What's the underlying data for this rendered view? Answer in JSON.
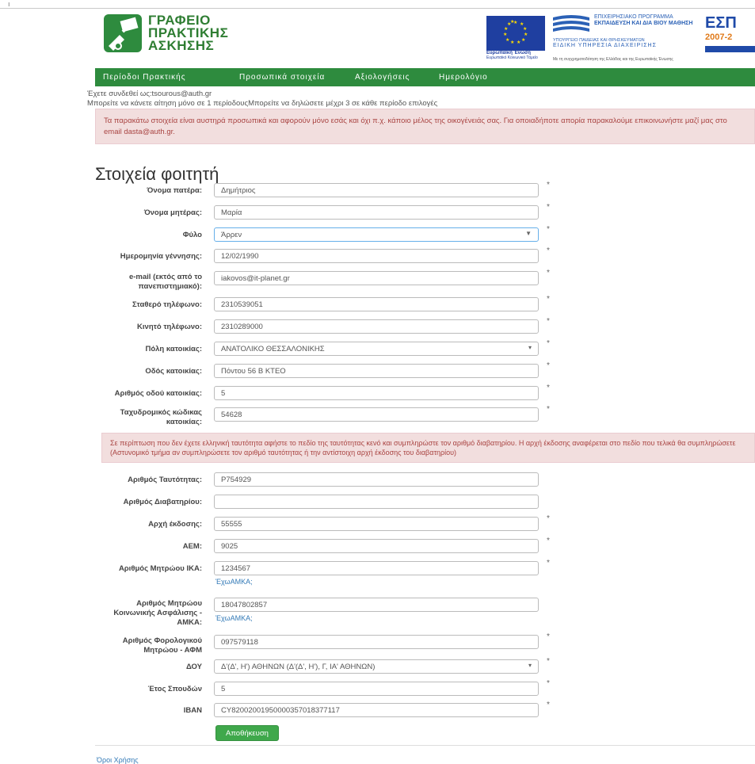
{
  "corner_mark": "ı",
  "header": {
    "logo_line1": "ΓΡΑΦΕΙΟ",
    "logo_line2": "ΠΡΑΚΤΙΚΗΣ",
    "logo_line3": "ΑΣΚΗΣΗΣ",
    "eu_title": "Ευρωπαϊκή Ένωση",
    "eu_subtitle": "Ευρωπαϊκό Κοινωνικό Ταμείο",
    "op_line1": "ΕΠΙΧΕΙΡΗΣΙΑΚΟ ΠΡΟΓΡΑΜΜΑ",
    "op_line2": "ΕΚΠΑΙΔΕΥΣΗ ΚΑΙ ΔΙΑ ΒΙΟΥ ΜΑΘΗΣΗ",
    "op_ministry1": "ΥΠΟΥΡΓΕΙΟ ΠΑΙΔΕΙΑΣ ΚΑΙ ΘΡΗΣΚΕΥΜΑΤΩΝ",
    "op_ministry2": "ΕΙΔΙΚΗ ΥΠΗΡΕΣΙΑ ΔΙΑΧΕΙΡΙΣΗΣ",
    "op_bottom": "Με τη συγχρηματοδότηση της Ελλάδας και της Ευρωπαϊκής Ένωσης",
    "espa_text": "ΕΣΠ",
    "espa_years": "2007-2"
  },
  "nav": {
    "items": [
      "Περίοδοι Πρακτικής",
      "Προσωπικά στοιχεία",
      "Αξιολογήσεις",
      "Ημερολόγιο"
    ]
  },
  "info": {
    "line1": "Έχετε συνδεθεί ως:tsourous@auth.gr",
    "line2": "Μπορείτε να κάνετε αίτηση μόνο σε 1 περίοδουςΜπορείτε να δηλώσετε μέχρι 3 σε κάθε περίοδο επιλογές"
  },
  "alert1": {
    "text": "Τα παρακάτω στοιχεία είναι αυστηρά προσωπικά και αφορούν μόνο εσάς και όχι π.χ. κάποιο μέλος της οικογένειάς σας. Για οποιαδήποτε απορία παρακαλούμε επικοινωνήστε μαζί μας στο email dasta@auth.gr."
  },
  "page_title": "Στοιχεία φοιτητή",
  "required_mark": "*",
  "fields": {
    "father": {
      "label": "Όνομα πατέρα:",
      "value": "Δημήτριος"
    },
    "mother": {
      "label": "Όνομα μητέρας:",
      "value": "Μαρία"
    },
    "gender": {
      "label": "Φύλο",
      "value": "Άρρεν"
    },
    "birthdate": {
      "label": "Ημερομηνία γέννησης:",
      "value": "12/02/1990"
    },
    "email": {
      "label": "e-mail (εκτός από το πανεπιστημιακό):",
      "value": "iakovos@it-planet.gr"
    },
    "landline": {
      "label": "Σταθερό τηλέφωνο:",
      "value": "2310539051"
    },
    "mobile": {
      "label": "Κινητό τηλέφωνο:",
      "value": "2310289000"
    },
    "city": {
      "label": "Πόλη κατοικίας:",
      "value": "ΑΝΑΤΟΛΙΚΟ ΘΕΣΣΑΛΟΝΙΚΗΣ"
    },
    "street": {
      "label": "Οδός κατοικίας:",
      "value": "Πόντου 56 Β ΚΤΕΟ"
    },
    "street_no": {
      "label": "Αριθμός οδού κατοικίας:",
      "value": "5"
    },
    "postal": {
      "label": "Ταχυδρομικός κώδικας κατοικίας:",
      "value": "54628"
    },
    "id_no": {
      "label": "Αριθμός Ταυτότητας:",
      "value": "Ρ754929"
    },
    "passport": {
      "label": "Αριθμός Διαβατηρίου:",
      "value": ""
    },
    "authority": {
      "label": "Αρχή έκδοσης:",
      "value": "55555"
    },
    "aem": {
      "label": "ΑΕΜ:",
      "value": "9025"
    },
    "ika": {
      "label": "Αριθμός Μητρώου ΙΚΑ:",
      "value": "1234567"
    },
    "amka": {
      "label": "Αριθμός Μητρώου Κοινωνικής Ασφάλισης - ΑΜΚΑ:",
      "value": "18047802857"
    },
    "afm": {
      "label": "Αριθμός Φορολογικού Μητρώου - ΑΦΜ",
      "value": "097579118"
    },
    "doy": {
      "label": "ΔΟΥ",
      "value": "Δ'(Δ', Η') ΑΘΗΝΩΝ (Δ'(Δ', Η'), Γ, ΙΑ' ΑΘΗΝΩΝ)"
    },
    "year": {
      "label": "Έτος Σπουδών",
      "value": "5"
    },
    "iban": {
      "label": "IBAN",
      "value": "CY82002001950000357018377117"
    }
  },
  "help_link": "ΈχωΑΜΚΑ;",
  "alert2": {
    "text": "Σε περίπτωση που δεν έχετε ελληνική ταυτότητα αφήστε το πεδίο της ταυτότητας κενό και συμπληρώστε τον αριθμό διαβατηρίου. Η αρχή έκδοσης αναφέρεται στο πεδίο που τελικά θα συμπληρώσετε (Αστυνομικό τμήμα αν συμπληρώσετε τον αριθμό ταυτότητας ή την αντίστοιχη αρχή έκδοσης του διαβατηρίου)"
  },
  "save_button": "Αποθήκευση",
  "footer_link": "Όροι Χρήσης"
}
